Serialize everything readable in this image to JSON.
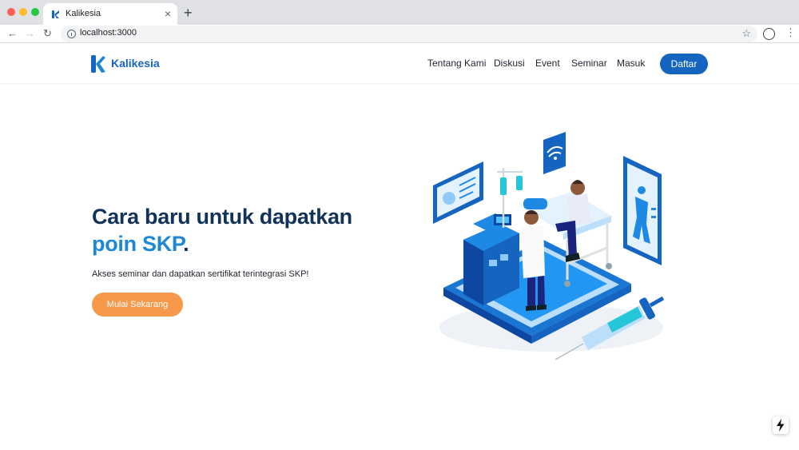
{
  "browser": {
    "tab_title": "Kalikesia",
    "tab_close": "×",
    "new_tab": "+",
    "url": "localhost:3000",
    "back": "←",
    "forward": "→",
    "reload": "↻",
    "star": "☆",
    "menu": "⋮"
  },
  "header": {
    "logo_text": "Kalikesia",
    "nav": [
      "Tentang Kami",
      "Diskusi",
      "Event",
      "Seminar",
      "Masuk"
    ],
    "cta": "Daftar"
  },
  "hero": {
    "title_line1": "Cara baru untuk dapatkan",
    "title_accent": "poin SKP",
    "title_end": ".",
    "subtitle": "Akses seminar dan dapatkan sertifikat terintegrasi SKP!",
    "button": "Mulai Sekarang"
  },
  "colors": {
    "brand_blue": "#1565c0",
    "title_navy": "#12325a",
    "accent_blue": "#1e88d4",
    "cta_orange": "#f6994a"
  },
  "icons": [
    "kalikesia-logo-icon",
    "info-icon",
    "star-icon",
    "profile-icon",
    "menu-icon",
    "lightning-icon",
    "medical-illustration"
  ]
}
